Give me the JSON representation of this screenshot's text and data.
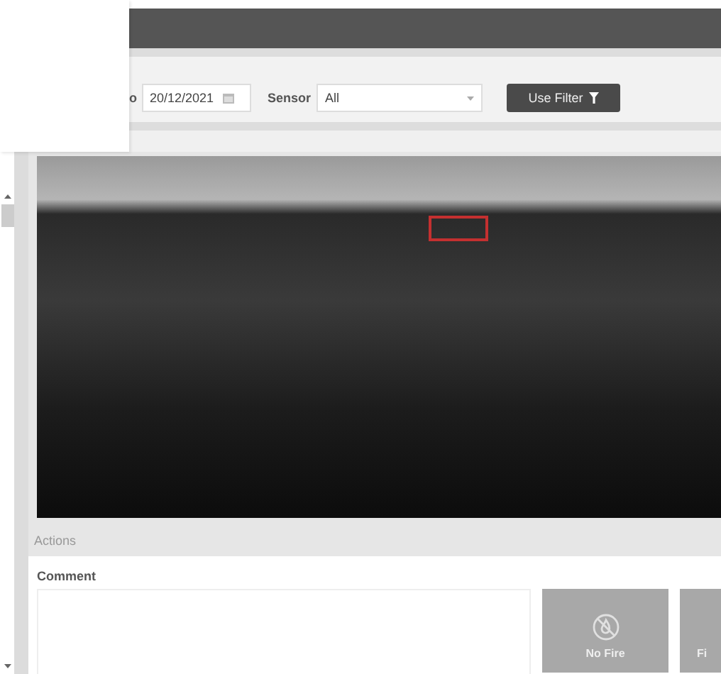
{
  "filter": {
    "date_label": "o",
    "date_value": "20/12/2021",
    "sensor_label": "Sensor",
    "sensor_value": "All",
    "button": "Use Filter"
  },
  "actions": {
    "title": "Actions",
    "comment_label": "Comment",
    "buttons": [
      {
        "label": "No Fire",
        "kind": "no-fire"
      },
      {
        "label": "Fi",
        "kind": "fire"
      }
    ]
  }
}
